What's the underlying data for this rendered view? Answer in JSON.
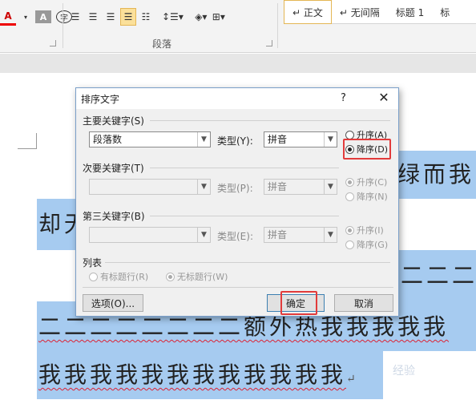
{
  "ribbon": {
    "font_color_btn": "A",
    "font_shade_btn": "A",
    "phonetic_btn": "字",
    "paragraph_group_label": "段落",
    "styles": [
      "↵ 正文",
      "↵ 无间隔",
      "标题 1",
      "标"
    ]
  },
  "document": {
    "line1_text": "绿而我",
    "line2_text": "却无",
    "line3_text": "二二二",
    "line4_text": "二二二二二二二二额外热我我我我我",
    "line5_text": "我我我我我我我我我我我我",
    "return_mark": "↵",
    "watermark": "经验"
  },
  "dialog": {
    "title": "排序文字",
    "help": "?",
    "close": "✕",
    "primary_key_label": "主要关键字(S)",
    "primary_key_value": "段落数",
    "primary_type_label": "类型(Y):",
    "primary_type_value": "拼音",
    "primary_asc": "升序(A)",
    "primary_desc": "降序(D)",
    "secondary_key_label": "次要关键字(T)",
    "secondary_type_label": "类型(P):",
    "secondary_type_value": "拼音",
    "secondary_asc": "升序(C)",
    "secondary_desc": "降序(N)",
    "tertiary_key_label": "第三关键字(B)",
    "tertiary_type_label": "类型(E):",
    "tertiary_type_value": "拼音",
    "tertiary_asc": "升序(I)",
    "tertiary_desc": "降序(G)",
    "list_label": "列表",
    "has_header": "有标题行(R)",
    "no_header": "无标题行(W)",
    "options_btn": "选项(O)...",
    "ok_btn": "确定",
    "cancel_btn": "取消"
  },
  "colors": {
    "highlight": "#a6cbf0",
    "annotation_box": "#e23b3b"
  }
}
